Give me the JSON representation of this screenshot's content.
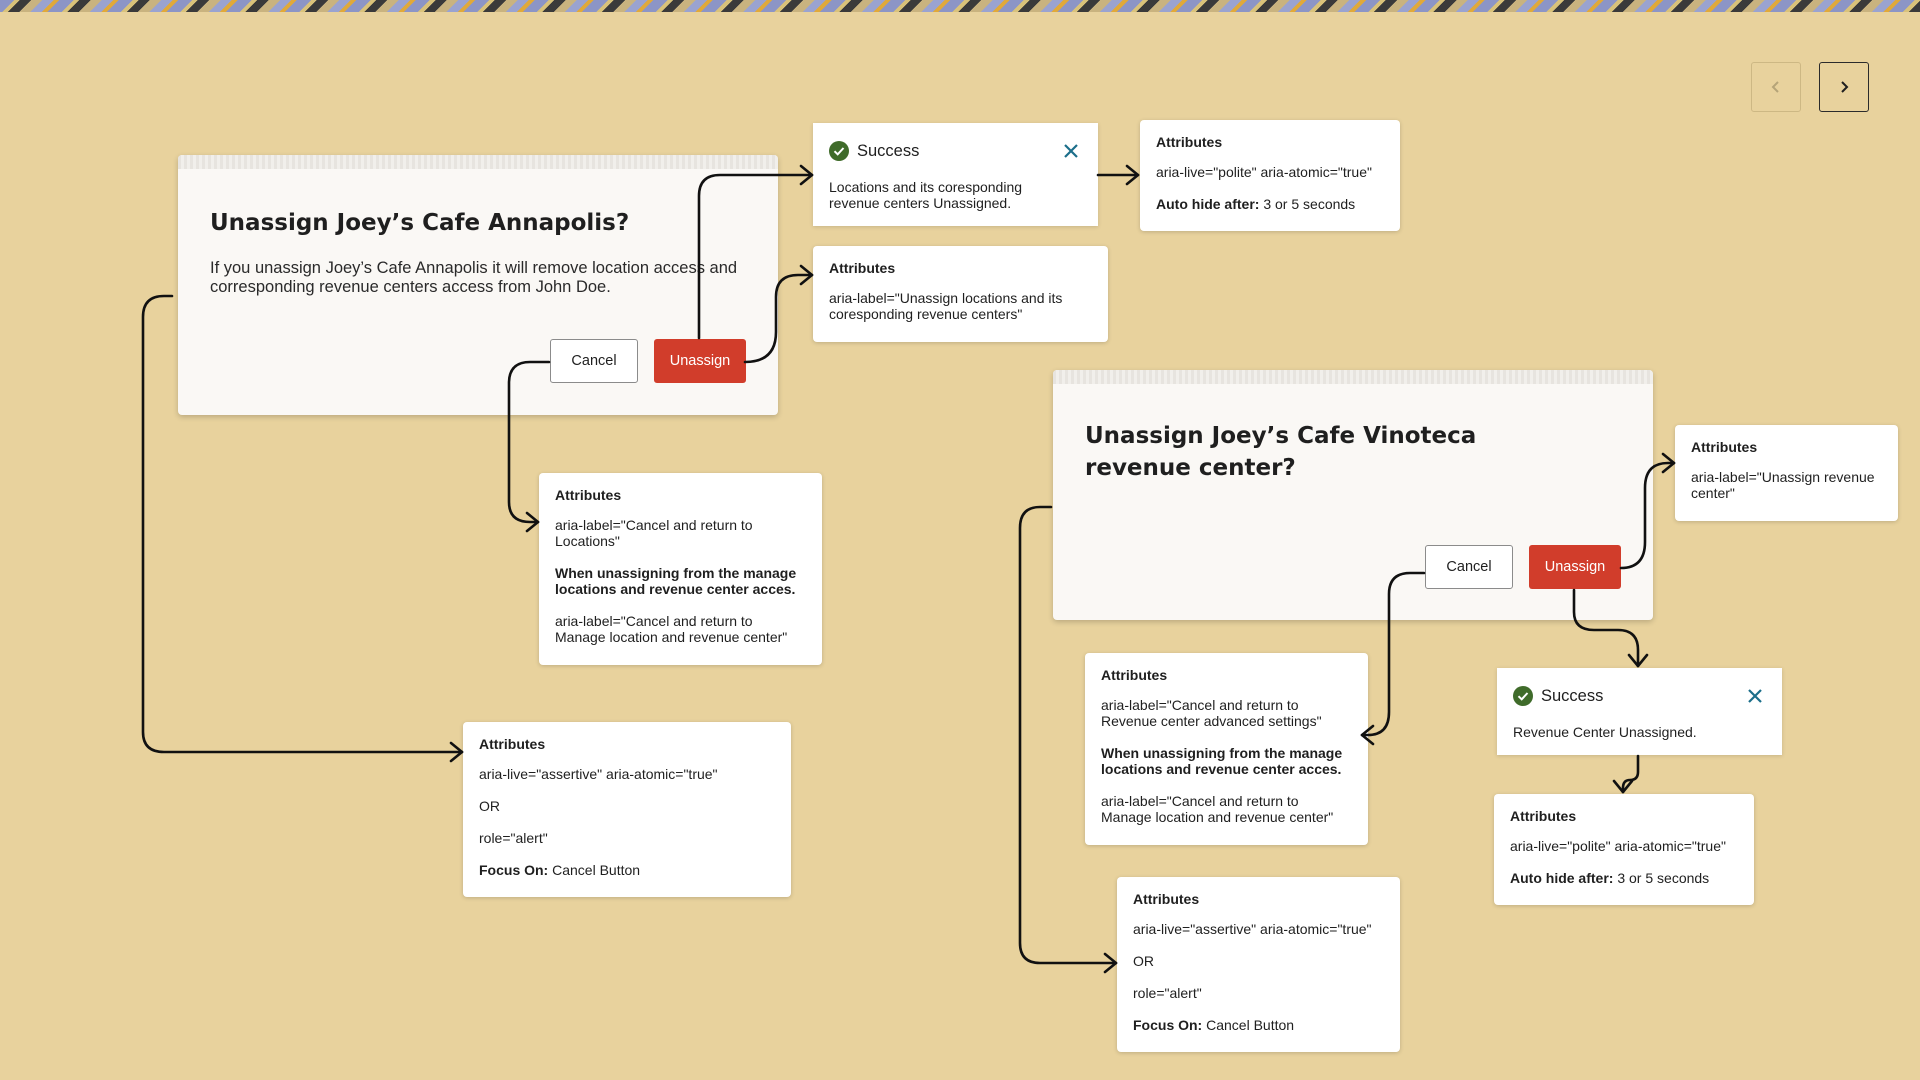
{
  "dialog1": {
    "title": "Unassign Joey’s Cafe Annapolis?",
    "body": "If you unassign Joey’s Cafe Annapolis it will remove location access and corresponding revenue centers access from John Doe.",
    "cancel_label": "Cancel",
    "unassign_label": "Unassign"
  },
  "dialog2": {
    "title": "Unassign Joey’s Cafe Vinoteca revenue center?",
    "cancel_label": "Cancel",
    "unassign_label": "Unassign"
  },
  "toast1": {
    "title": "Success",
    "message": "Locations and its coresponding revenue centers Unassigned."
  },
  "toast2": {
    "title": "Success",
    "message": "Revenue Center Unassigned."
  },
  "attr_toast1": {
    "heading": "Attributes",
    "line1": "aria-live=\"polite\" aria-atomic=\"true\"",
    "line2_label": "Auto hide after:",
    "line2_value": " 3 or 5 seconds"
  },
  "attr_unassign1": {
    "heading": "Attributes",
    "line1": "aria-label=\"Unassign locations and its coresponding revenue centers\""
  },
  "attr_cancel1": {
    "heading": "Attributes",
    "line1": "aria-label=\"Cancel and return to Locations\"",
    "line2": "When unassigning from the manage locations and revenue center acces.",
    "line3": "aria-label=\"Cancel and return to Manage location and revenue center\""
  },
  "attr_dialog1": {
    "heading": "Attributes",
    "line1": "aria-live=\"assertive\" aria-atomic=\"true\"",
    "line2": "OR",
    "line3": "role=\"alert\"",
    "line4_label": "Focus On:",
    "line4_value": " Cancel Button"
  },
  "attr_unassign2": {
    "heading": "Attributes",
    "line1": "aria-label=\"Unassign revenue center\""
  },
  "attr_cancel2": {
    "heading": "Attributes",
    "line1": "aria-label=\"Cancel and return to Revenue center advanced settings\"",
    "line2": "When unassigning from the manage locations and revenue center acces.",
    "line3": "aria-label=\"Cancel and return to Manage location and revenue center\""
  },
  "attr_toast2": {
    "heading": "Attributes",
    "line1": "aria-live=\"polite\" aria-atomic=\"true\"",
    "line2_label": "Auto hide after:",
    "line2_value": " 3 or 5 seconds"
  },
  "attr_dialog2": {
    "heading": "Attributes",
    "line1": "aria-live=\"assertive\" aria-atomic=\"true\"",
    "line2": "OR",
    "line3": "role=\"alert\"",
    "line4_label": "Focus On:",
    "line4_value": " Cancel Button"
  },
  "icons": {
    "prev": "chevron-left-icon",
    "next": "chevron-right-icon",
    "success": "check-circle-icon",
    "close": "close-icon"
  },
  "colors": {
    "background": "#e8d29d",
    "danger": "#d13d2b",
    "success": "#3f6b2a",
    "close": "#1b6e8a"
  }
}
